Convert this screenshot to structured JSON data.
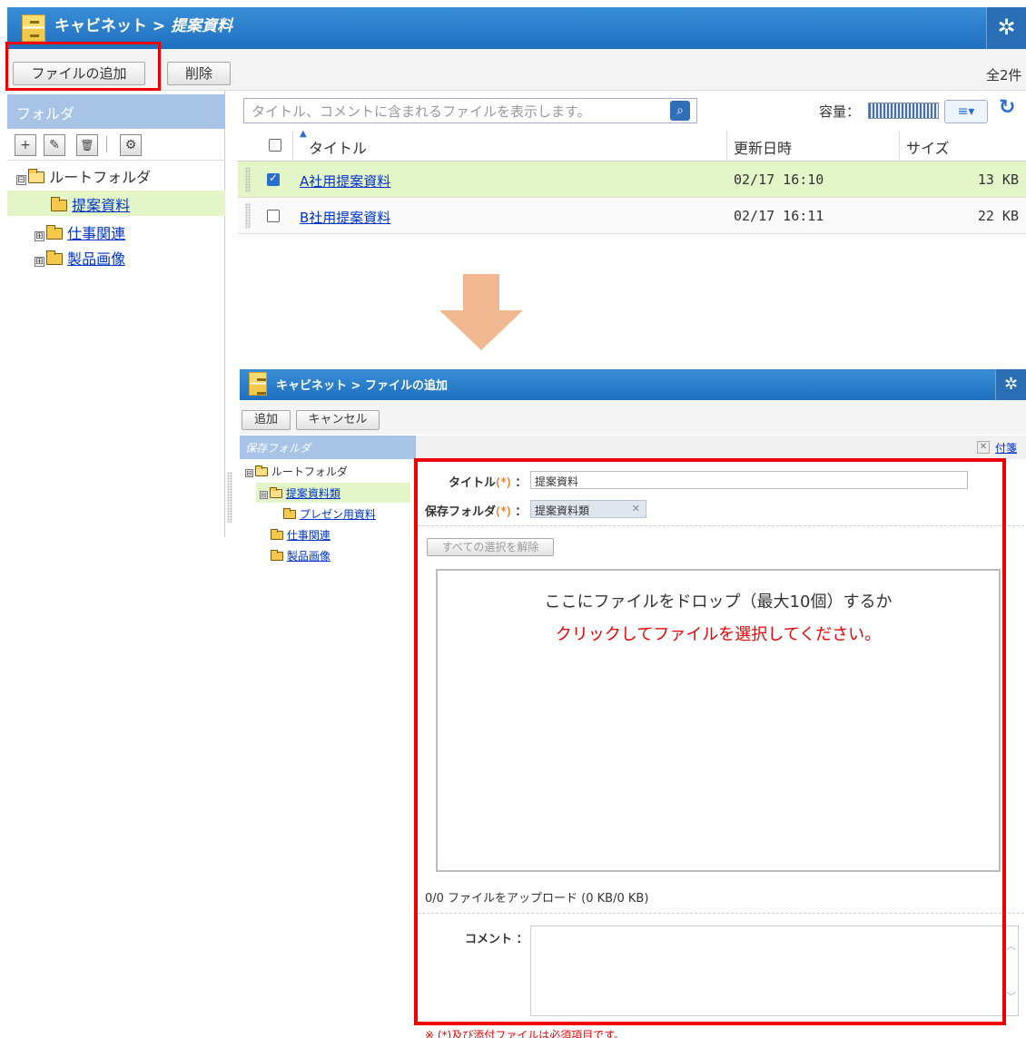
{
  "top": {
    "breadcrumb_root": "キャビネット",
    "breadcrumb_sep": ">",
    "breadcrumb_current": "提案資料",
    "toolbar": {
      "add_file": "ファイルの追加",
      "delete": "削除",
      "total": "全2件"
    },
    "folder_header": "フォルダ",
    "folder_tools": [
      "+",
      "✎",
      "🗑",
      "⚙"
    ],
    "tree": {
      "collapse": "⊟",
      "expand": "⊞",
      "root": "ルートフォルダ",
      "items": [
        "提案資料",
        "仕事関連",
        "製品画像"
      ]
    },
    "search": {
      "placeholder": "タイトル、コメントに含まれるファイルを表示します。"
    },
    "capacity_label": "容量：",
    "columns": {
      "title": "タイトル",
      "updated": "更新日時",
      "size": "サイズ"
    },
    "rows": [
      {
        "title": "A社用提案資料",
        "updated": "02/17 16:10",
        "size": "13 KB",
        "checked": true
      },
      {
        "title": "B社用提案資料",
        "updated": "02/17 16:11",
        "size": "22 KB",
        "checked": false
      }
    ]
  },
  "bottom": {
    "breadcrumb": "キャビネット > ファイルの追加",
    "toolbar": {
      "add": "追加",
      "cancel": "キャンセル"
    },
    "folder_header": "保存フォルダ",
    "sticky_label": "付箋",
    "tree": {
      "root": "ルートフォルダ",
      "selected": "提案資料類",
      "child": "プレゼン用資料",
      "others": [
        "仕事関連",
        "製品画像"
      ]
    },
    "form": {
      "title_label": "タイトル",
      "title_value": "提案資料",
      "folder_label": "保存フォルダ",
      "folder_value": "提案資料類",
      "required_mark": "(*)",
      "label_suffix": "：",
      "clear_selection": "すべての選択を解除",
      "drop_line1": "ここにファイルをドロップ（最大10個）するか",
      "drop_line2": "クリックしてファイルを選択してください。",
      "upload_status": "0/0 ファイルをアップロード (0 KB/0 KB)",
      "comment_label": "コメント",
      "note": "※ (*)及び添付ファイルは必須項目です。"
    }
  },
  "colors": {
    "header_blue": "#2a7fd0",
    "selected_row": "#e4f6c8",
    "highlight_red": "#ee0000",
    "arrow": "#f2b891"
  }
}
